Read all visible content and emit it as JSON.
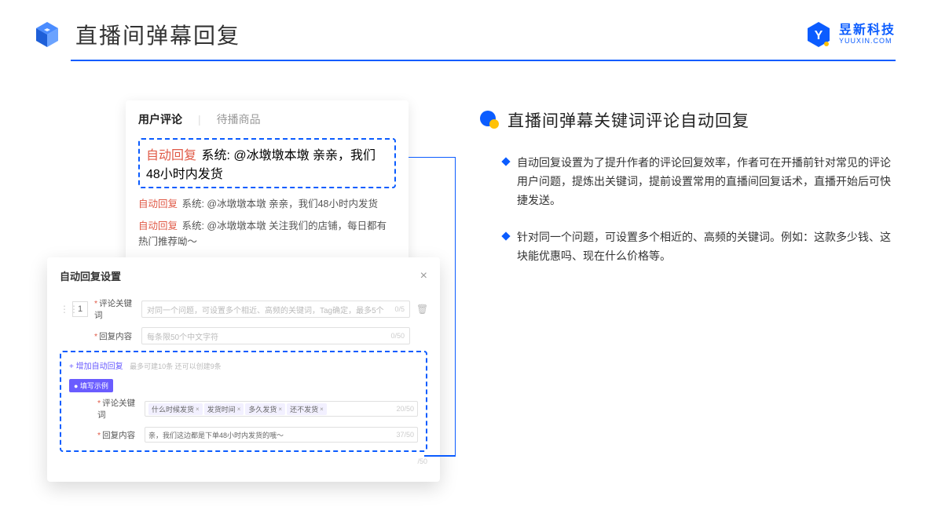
{
  "header": {
    "title": "直播间弹幕回复",
    "brand_name": "昱新科技",
    "brand_sub": "YUUXIN.COM"
  },
  "comment_panel": {
    "tab_active": "用户评论",
    "tab_inactive": "待播商品",
    "highlighted": {
      "tag": "自动回复",
      "text": " 系统: @冰墩墩本墩 亲亲，我们48小时内发货"
    },
    "items": [
      {
        "tag": "自动回复",
        "text": " 系统: @冰墩墩本墩 亲亲，我们48小时内发货"
      },
      {
        "tag": "自动回复",
        "text": " 系统: @冰墩墩本墩 关注我们的店铺，每日都有热门推荐呦～"
      }
    ]
  },
  "settings": {
    "title": "自动回复设置",
    "order": "1",
    "row1": {
      "label": "评论关键词",
      "placeholder": "对同一个问题，可设置多个相近、高频的关键词，Tag确定，最多5个",
      "count": "0/5"
    },
    "row2": {
      "label": "回复内容",
      "placeholder": "每条限50个中文字符",
      "count": "0/50"
    },
    "add_link": "+ 增加自动回复",
    "add_hint": "最多可建10条 还可以创建9条",
    "example_badge": "● 填写示例",
    "ex_row1": {
      "label": "评论关键词",
      "tags": [
        "什么时候发货",
        "发货时间",
        "多久发货",
        "还不发货"
      ],
      "count": "20/50"
    },
    "ex_row2": {
      "label": "回复内容",
      "text": "亲，我们这边都是下单48小时内发货的哦～",
      "count": "37/50"
    },
    "outer_count": "/50"
  },
  "right": {
    "heading": "直播间弹幕关键词评论自动回复",
    "bullets": [
      "自动回复设置为了提升作者的评论回复效率，作者可在开播前针对常见的评论用户问题，提炼出关键词，提前设置常用的直播间回复话术，直播开始后可快捷发送。",
      "针对同一个问题，可设置多个相近的、高频的关键词。例如：这款多少钱、这块能优惠吗、现在什么价格等。"
    ]
  }
}
